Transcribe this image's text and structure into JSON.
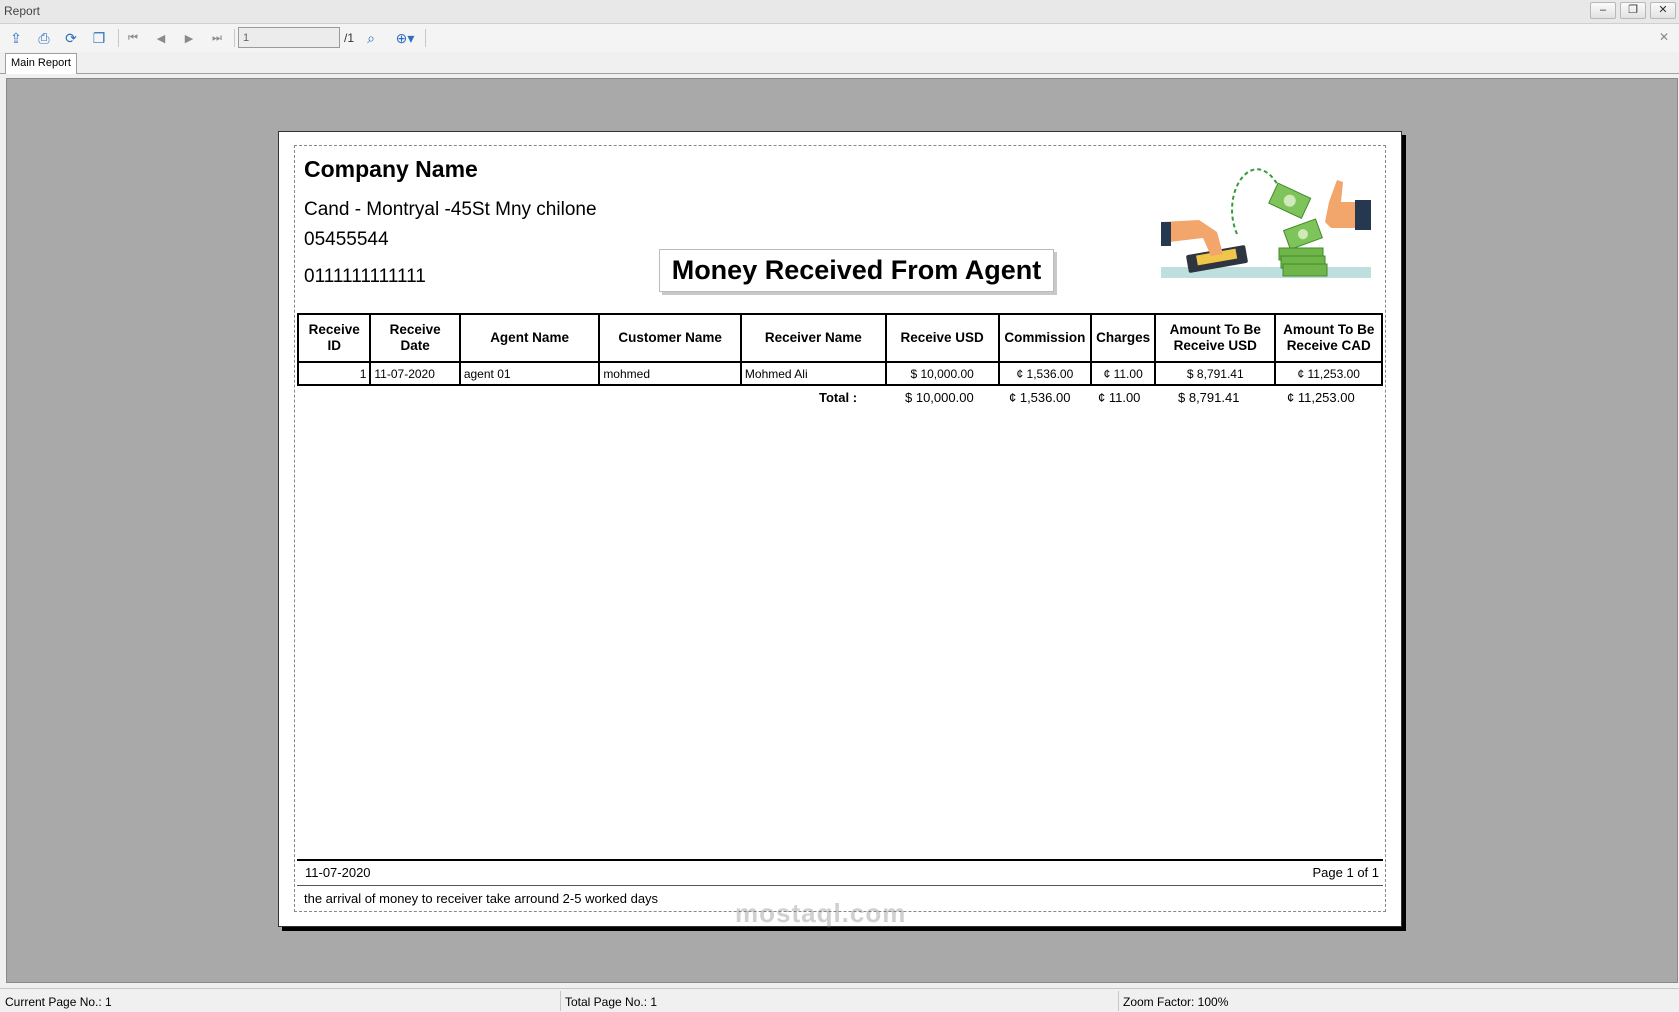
{
  "window": {
    "title": "Report"
  },
  "toolbar": {
    "page_value": "1",
    "page_total": "/1"
  },
  "tabs": [
    {
      "label": "Main Report"
    }
  ],
  "report": {
    "company_name": "Company Name",
    "address": "Cand - Montryal -45St Mny chilone",
    "phone1": "05455544",
    "phone2": "0111111111111",
    "title": "Money Received From Agent",
    "columns": [
      "Receive ID",
      "Receive Date",
      "Agent Name",
      "Customer Name",
      "Receiver Name",
      "Receive USD",
      "Commission",
      "Charges",
      "Amount To Be Receive USD",
      "Amount To Be Receive CAD"
    ],
    "rows": [
      {
        "id": "1",
        "date": "11-07-2020",
        "agent": "agent 01",
        "customer": "mohmed",
        "receiver": "Mohmed Ali",
        "usd": "$ 10,000.00",
        "commission": "¢ 1,536.00",
        "charges": "¢ 11.00",
        "amt_usd": "$ 8,791.41",
        "amt_cad": "¢ 11,253.00"
      }
    ],
    "totals": {
      "label": "Total :",
      "usd": "$ 10,000.00",
      "commission": "¢ 1,536.00",
      "charges": "¢ 11.00",
      "amt_usd": "$ 8,791.41",
      "amt_cad": "¢ 11,253.00"
    },
    "footer": {
      "date": "11-07-2020",
      "page": "Page 1 of 1",
      "note": "the arrival of money to receiver take arround 2-5 worked days"
    }
  },
  "status": {
    "current_page": "Current Page No.: 1",
    "total_page": "Total Page No.: 1",
    "zoom": "Zoom Factor: 100%"
  },
  "watermark": "mostaql.com"
}
